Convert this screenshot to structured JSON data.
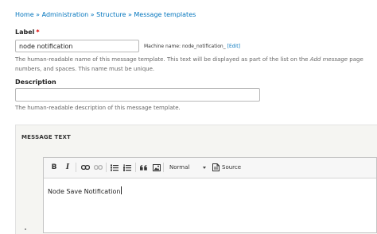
{
  "breadcrumb": {
    "items": [
      "Home",
      "Administration",
      "Structure",
      "Message templates"
    ],
    "separator": "»"
  },
  "label_field": {
    "label": "Label",
    "required_marker": "*",
    "value": "node notification",
    "machine_name_prefix": "Machine name: node_notification_",
    "edit_link": "[Edit]",
    "help_line1_start": "The human-readable name of this message template. This text will be displayed as part of the list on the ",
    "help_line1_em": "Add message",
    "help_line1_end": " page",
    "help_line2": "numbers, and spaces. This name must be unique."
  },
  "description_field": {
    "label": "Description",
    "value": "",
    "help": "The human-readable description of this message template."
  },
  "message_text": {
    "title": "MESSAGE TEXT",
    "toolbar": {
      "bold": "B",
      "italic": "I",
      "format_value": "Normal",
      "source_label": "Source"
    },
    "content": "Node Save Notification"
  },
  "colors": {
    "link": "#0074bd",
    "required": "#e00000",
    "section_bg": "#f5f5f2"
  }
}
